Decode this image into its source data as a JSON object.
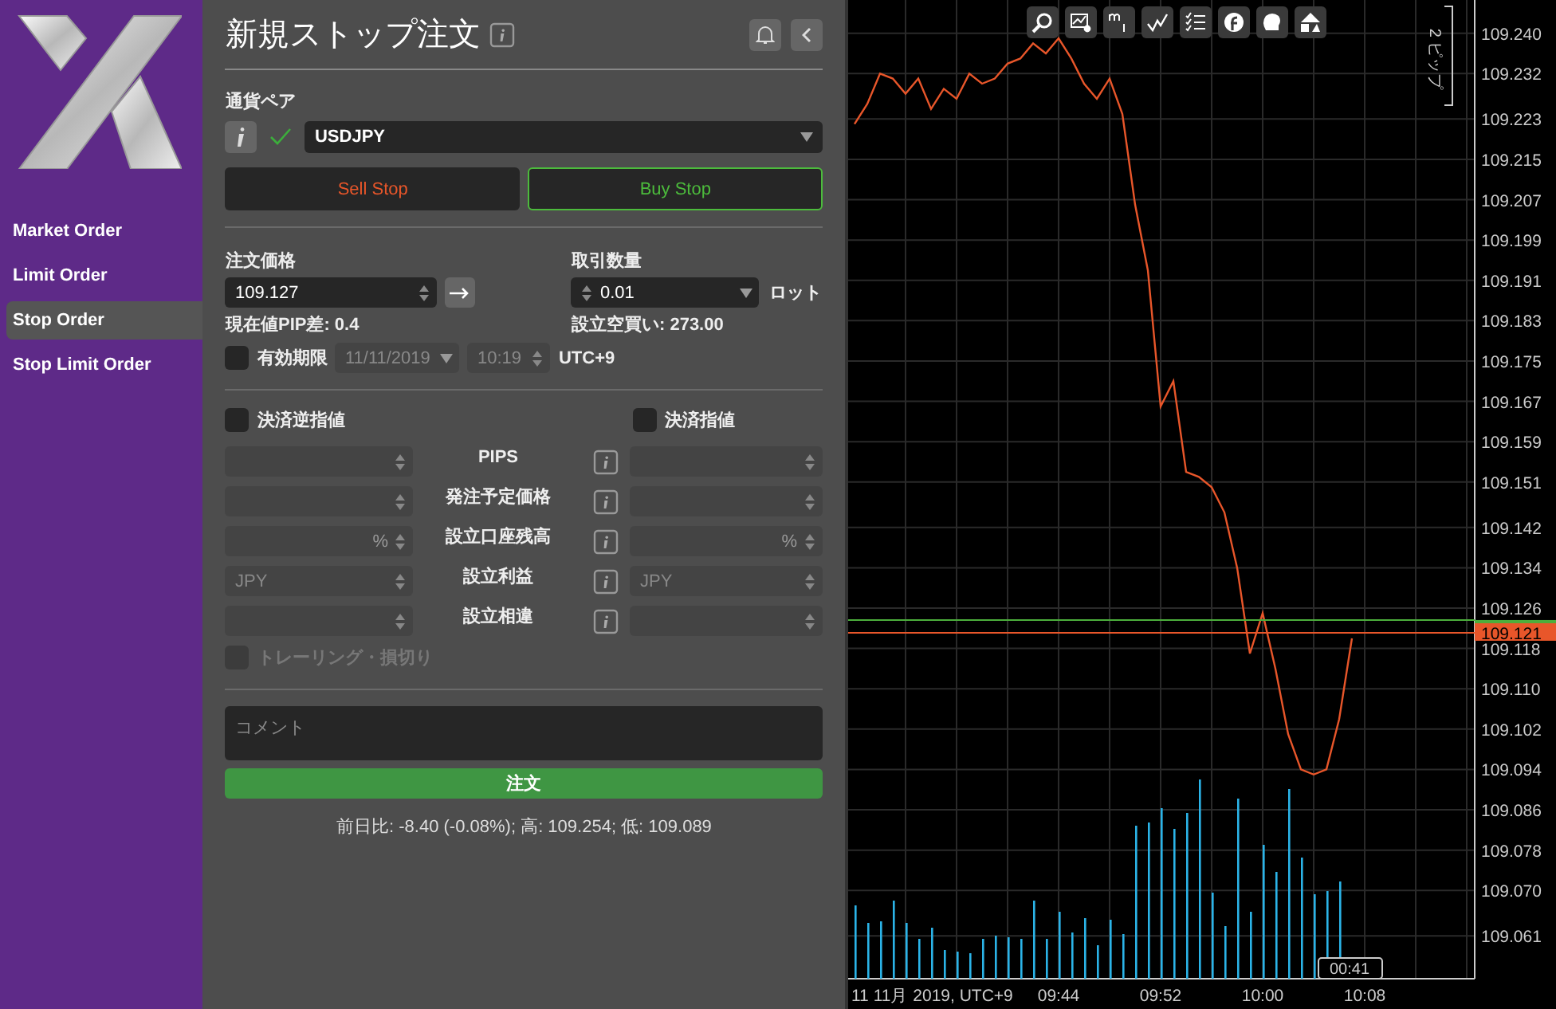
{
  "sidebar": {
    "items": [
      {
        "label": "Market Order",
        "selected": false
      },
      {
        "label": "Limit Order",
        "selected": false
      },
      {
        "label": "Stop Order",
        "selected": true
      },
      {
        "label": "Stop Limit Order",
        "selected": false
      }
    ]
  },
  "form": {
    "title": "新規ストップ注文",
    "pair_label": "通貨ペア",
    "pair": "USDJPY",
    "pair_valid": true,
    "sides": [
      {
        "label": "Sell Stop",
        "kind": "sell",
        "selected": false
      },
      {
        "label": "Buy Stop",
        "kind": "buy",
        "selected": true
      }
    ],
    "price_label": "注文価格",
    "price": "109.127",
    "pip_diff": "現在値PIP差: 0.4",
    "quantity_label": "取引数量",
    "quantity": "0.01",
    "quantity_unit": "ロット",
    "margin": "設立空買い: 273.00",
    "expiry": {
      "checked": false,
      "label": "有効期限",
      "date": "11/11/2019",
      "time": "10:19",
      "timezone": "UTC+9"
    },
    "stop_loss": {
      "checked": false,
      "label": "決済逆指値"
    },
    "take_profit": {
      "checked": false,
      "label": "決済指値"
    },
    "rows": [
      {
        "label": "PIPS"
      },
      {
        "label": "発注予定価格"
      },
      {
        "label": "設立口座残高",
        "left_unit": "%",
        "right_unit": "%"
      },
      {
        "label": "設立利益",
        "left_placeholder": "JPY",
        "right_placeholder": "JPY"
      },
      {
        "label": "設立相違"
      }
    ],
    "trailing": {
      "label": "トレーリング・損切り",
      "checked": false,
      "disabled": true
    },
    "comment_placeholder": "コメント",
    "submit": "注文",
    "stats": "前日比: -8.40 (-0.08%); 高: 109.254; 低: 109.089"
  },
  "chart": {
    "pip_scale": "2 ピップ",
    "date_label": "11 11月 2019, UTC+9",
    "bid": "109.121",
    "cursor_time": "00:41",
    "chart_data": {
      "type": "line",
      "grid": true,
      "categories": [
        null,
        null,
        null,
        null,
        null,
        null,
        null,
        null,
        null,
        null,
        null,
        null,
        null,
        null,
        null,
        null,
        "09:44",
        null,
        null,
        null,
        null,
        null,
        null,
        null,
        "09:52",
        null,
        null,
        null,
        null,
        null,
        null,
        null,
        "10:00",
        null,
        null,
        null,
        null,
        null,
        null,
        null,
        "10:08"
      ],
      "series": [
        {
          "color": "#e8562a",
          "values": [
            109.222,
            109.226,
            109.232,
            109.231,
            109.228,
            109.231,
            109.225,
            109.229,
            109.227,
            109.232,
            109.23,
            109.231,
            109.234,
            109.235,
            109.238,
            109.236,
            109.239,
            109.235,
            109.23,
            109.227,
            109.231,
            109.224,
            109.206,
            109.193,
            109.166,
            109.171,
            109.153,
            109.152,
            109.15,
            109.145,
            109.134,
            109.117,
            109.125,
            109.114,
            109.101,
            109.094,
            109.093,
            109.094,
            109.104,
            109.12,
            null
          ]
        }
      ],
      "ylim": [
        109.0525,
        109.2466
      ],
      "yticks": [
        {
          "value": 109.24,
          "label": "109.240"
        },
        109.232,
        109.223,
        109.215,
        109.207,
        109.199,
        109.191,
        109.183,
        109.175,
        109.167,
        109.159,
        109.151,
        109.142,
        109.134,
        109.126,
        109.118,
        {
          "value": 109.11,
          "label": "109.110"
        },
        109.102,
        109.094,
        109.086,
        109.078,
        {
          "value": 109.07,
          "label": "109.070"
        },
        109.061
      ]
    }
  }
}
